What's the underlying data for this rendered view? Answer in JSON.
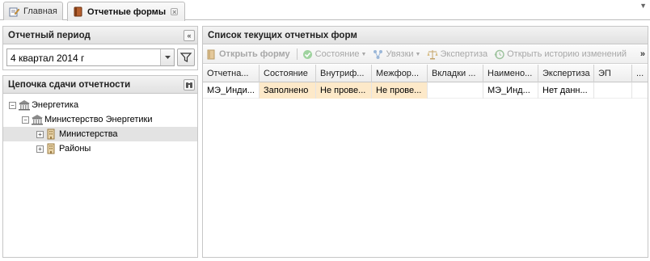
{
  "tabs": [
    {
      "label": "Главная"
    },
    {
      "label": "Отчетные формы",
      "close": "×"
    }
  ],
  "top_dropdown": "▼",
  "left_top": {
    "title": "Отчетный период",
    "collapse_icon": "«",
    "period_value": "4 квартал 2014 г"
  },
  "left_bottom": {
    "title": "Цепочка сдачи отчетности",
    "tree": [
      {
        "label": "Энергетика",
        "expander": "−"
      },
      {
        "label": "Министерство Энергетики",
        "expander": "−"
      },
      {
        "label": "Министерства",
        "expander": "+"
      },
      {
        "label": "Районы",
        "expander": "+"
      }
    ]
  },
  "right": {
    "title": "Список текущих отчетных форм",
    "toolbar": {
      "open_form": "Открыть форму",
      "state": "Состояние",
      "links": "Увязки",
      "expertise": "Экспертиза",
      "history": "Открыть историю изменений",
      "more": "»"
    },
    "columns": [
      "Отчетна...",
      "Состояние",
      "Внутриф...",
      "Межфор...",
      "Вкладки ...",
      "Наимено...",
      "Экспертиза",
      "ЭП",
      "..."
    ],
    "rows": [
      [
        "МЭ_Инди...",
        "Заполнено",
        "Не прове...",
        "Не прове...",
        "",
        "МЭ_Инд...",
        "Нет данн...",
        "",
        ""
      ]
    ]
  },
  "colors": {
    "highlight_cell": "#fde9c9",
    "selected_tree_row": "#e3e3e3",
    "toolbar_disabled_text": "#a7a7a7"
  }
}
